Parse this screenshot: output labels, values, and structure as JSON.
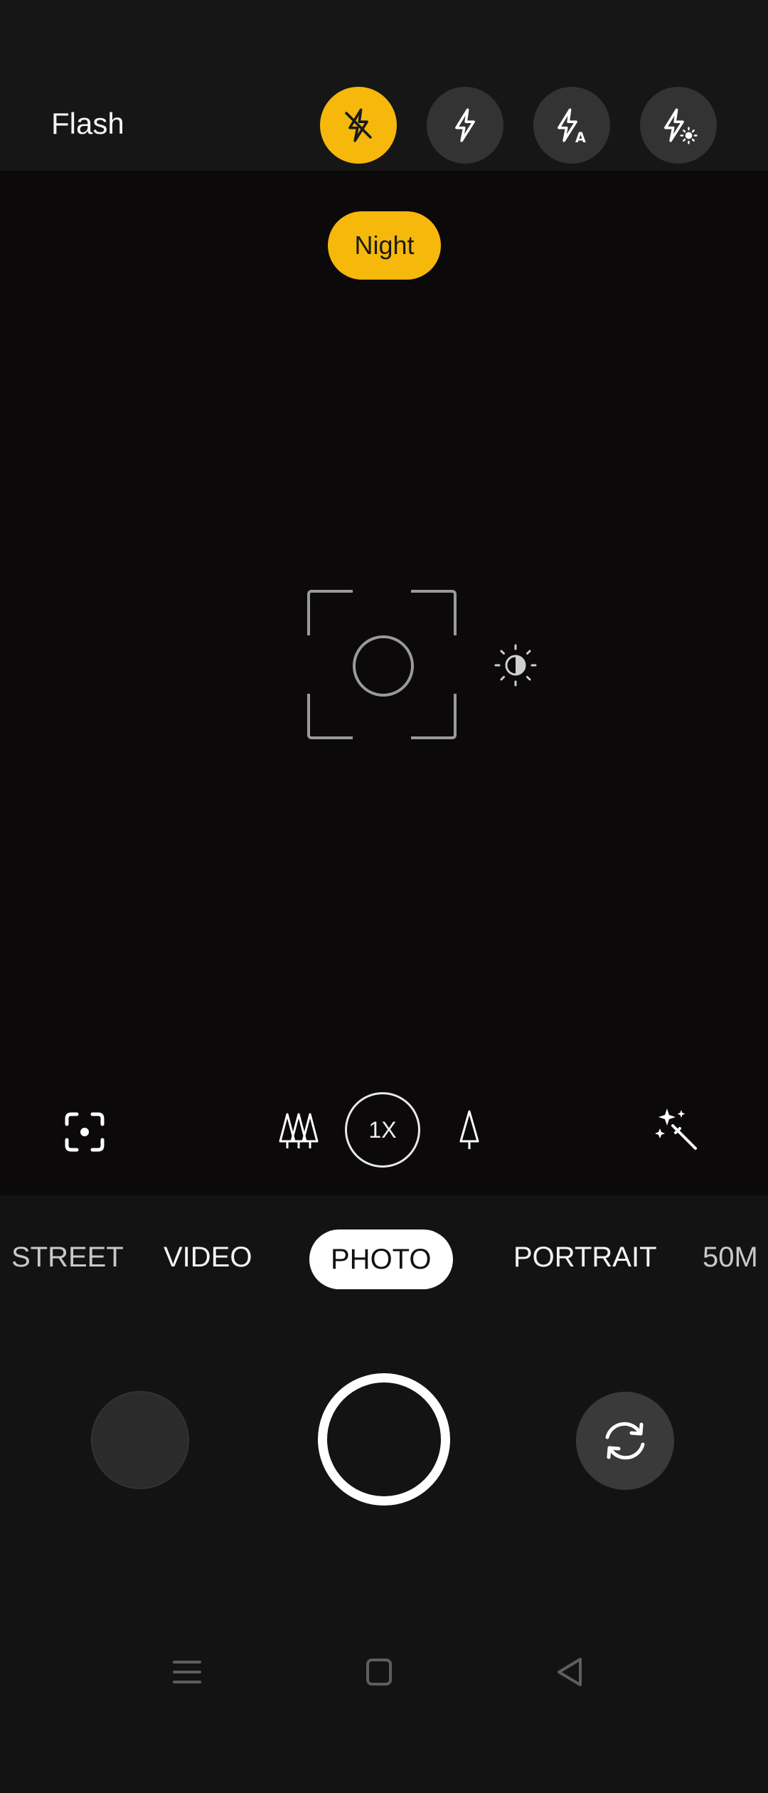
{
  "flash": {
    "label": "Flash",
    "options": [
      {
        "icon": "flash-off-icon",
        "selected": true
      },
      {
        "icon": "flash-on-icon",
        "selected": false
      },
      {
        "icon": "flash-auto-icon",
        "selected": false
      },
      {
        "icon": "flash-torch-icon",
        "selected": false
      }
    ]
  },
  "viewfinder": {
    "night_label": "Night"
  },
  "tools": {
    "zoom_label": "1X",
    "icons": [
      "scan-icon",
      "wide-trees-icon",
      "tele-tree-icon",
      "magic-wand-icon"
    ]
  },
  "modes": {
    "items": [
      "STREET",
      "VIDEO",
      "PHOTO",
      "PORTRAIT",
      "50M"
    ],
    "active": "PHOTO"
  },
  "colors": {
    "accent": "#f5b80b",
    "background": "#131313"
  }
}
